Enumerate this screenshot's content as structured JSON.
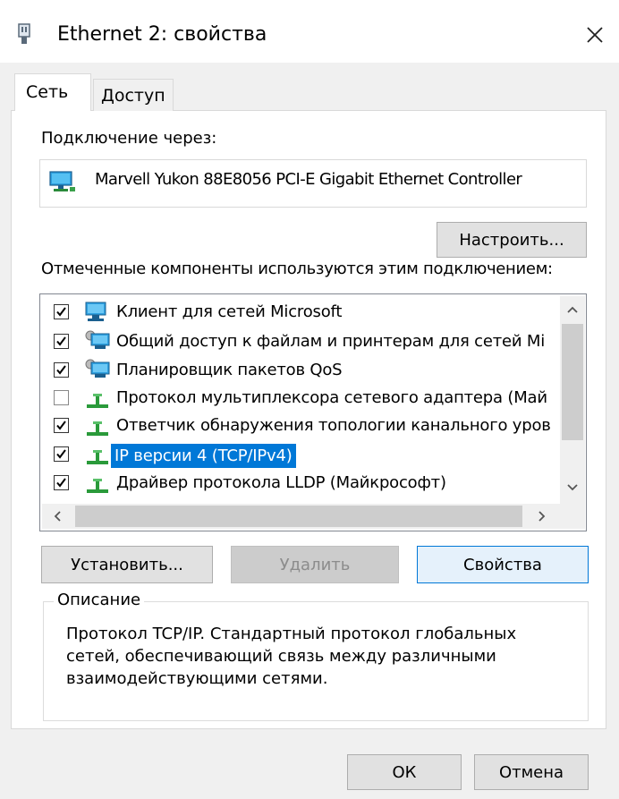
{
  "window": {
    "title": "Ethernet 2: свойства"
  },
  "tabs": [
    {
      "label": "Сеть"
    },
    {
      "label": "Доступ"
    }
  ],
  "connection": {
    "label": "Подключение через:",
    "adapter": "Marvell Yukon 88E8056 PCI-E Gigabit Ethernet Controller",
    "configure_button": "Настроить..."
  },
  "components": {
    "label": "Отмеченные компоненты используются этим подключением:",
    "items": [
      {
        "label": "Клиент для сетей Microsoft",
        "checked": true,
        "icon": "network-client-icon"
      },
      {
        "label": "Общий доступ к файлам и принтерам для сетей Mi",
        "checked": true,
        "icon": "network-service-icon"
      },
      {
        "label": "Планировщик пакетов QoS",
        "checked": true,
        "icon": "network-service-icon"
      },
      {
        "label": "Протокол мультиплексора сетевого адаптера (Май",
        "checked": false,
        "icon": "protocol-icon"
      },
      {
        "label": "Ответчик обнаружения топологии канального уров",
        "checked": true,
        "icon": "protocol-icon"
      },
      {
        "label": "IP версии 4 (TCP/IPv4)",
        "checked": true,
        "icon": "protocol-icon",
        "selected": true
      },
      {
        "label": "Драйвер протокола LLDP (Майкрософт)",
        "checked": true,
        "icon": "protocol-icon"
      }
    ]
  },
  "buttons": {
    "install": "Установить...",
    "remove": "Удалить",
    "properties": "Свойства",
    "ok": "ОК",
    "cancel": "Отмена"
  },
  "description": {
    "legend": "Описание",
    "text": "Протокол TCP/IP. Стандартный протокол глобальных сетей, обеспечивающий связь между различными взаимодействующими сетями."
  },
  "colors": {
    "selection": "#0078d7",
    "window_bg": "#f0f0f0"
  }
}
